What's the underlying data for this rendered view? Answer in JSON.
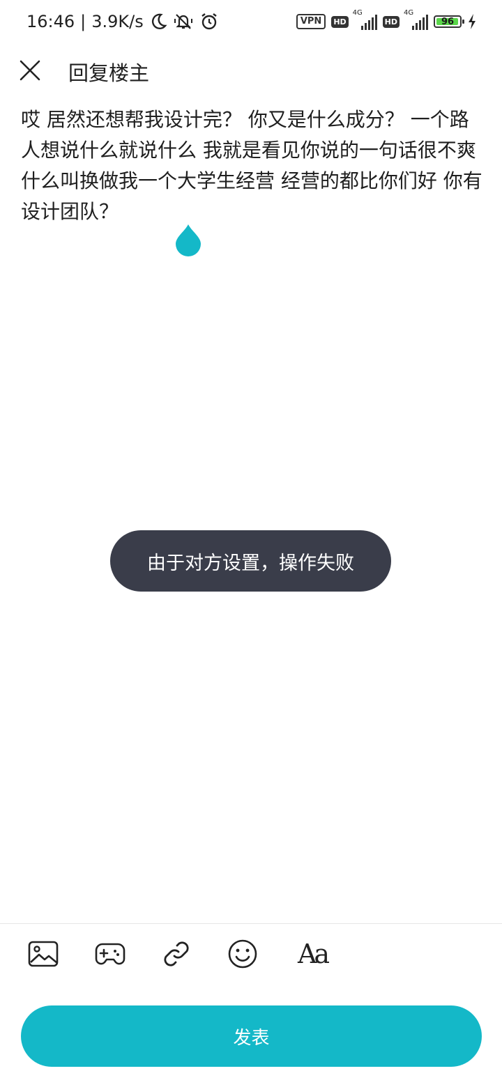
{
  "status_bar": {
    "time": "16:46",
    "speed": "3.9K/s",
    "vpn_label": "VPN",
    "hd1": "HD",
    "net1": "4G",
    "hd2": "HD",
    "net2": "4G",
    "battery": "96"
  },
  "header": {
    "title": "回复楼主"
  },
  "reply": {
    "text": "哎 居然还想帮我设计完？ 你又是什么成分？ 一个路人想说什么就说什么 我就是看见你说的一句话很不爽 什么叫换做我一个大学生经营 经营的都比你们好 你有设计团队？"
  },
  "toast": {
    "message": "由于对方设置，操作失败"
  },
  "toolbar": {
    "font_label": "Aa"
  },
  "submit_label": "发表",
  "colors": {
    "accent": "#14b8c8",
    "toast_bg": "#3a3d4a",
    "battery_fill": "#5ad64a"
  }
}
